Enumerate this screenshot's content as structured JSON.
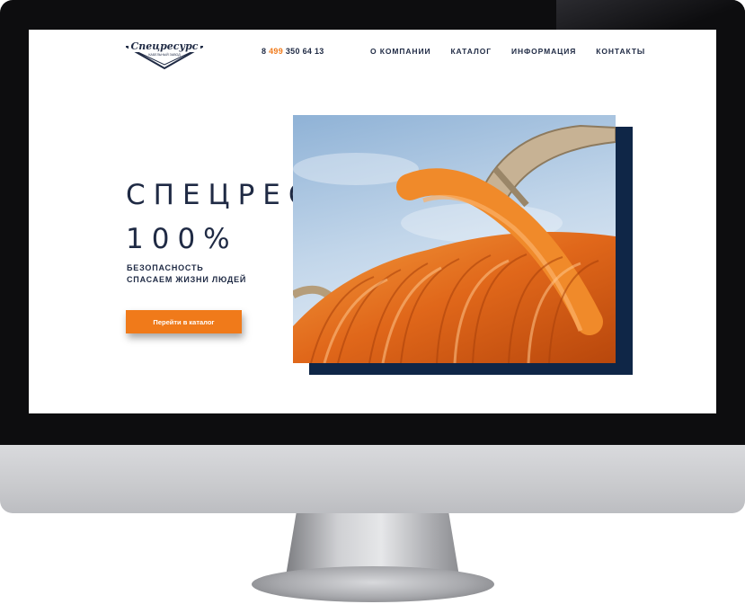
{
  "header": {
    "logo_text": "Спецресурс",
    "logo_tagline": "КАБЕЛЬНЫЙ ЗАВОД",
    "phone_prefix": "8",
    "phone_code": "499",
    "phone_number": "350 64 13"
  },
  "nav": {
    "items": [
      {
        "label": "О КОМПАНИИ"
      },
      {
        "label": "КАТАЛОГ"
      },
      {
        "label": "ИНФОРМАЦИЯ"
      },
      {
        "label": "КОНТАКТЫ"
      }
    ]
  },
  "hero": {
    "title_line1": "СПЕЦРЕСУРС",
    "title_line2": "100%",
    "subtitle_line1": "БЕЗОПАСНОСТЬ",
    "subtitle_line2": "СПАСАЕМ ЖИЗНИ ЛЮДЕЙ",
    "cta_label": "Перейти в каталог"
  },
  "colors": {
    "accent": "#f07a1a",
    "dark_blue": "#1f2a44",
    "navy_block": "#0f2647"
  }
}
